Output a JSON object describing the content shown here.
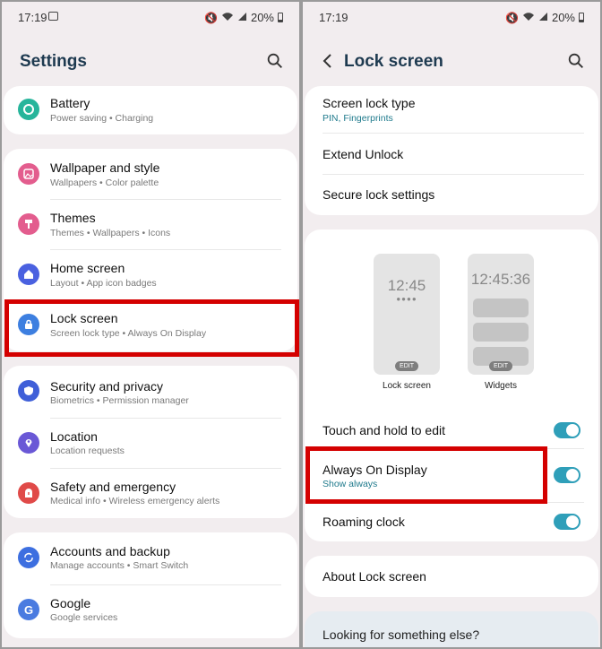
{
  "status": {
    "time": "17:19",
    "battery": "20%"
  },
  "left": {
    "title": "Settings",
    "groups": [
      {
        "items": [
          {
            "label": "Battery",
            "sub": "Power saving  •  Charging",
            "icon": "battery-icon",
            "color": "#27b59b"
          }
        ]
      },
      {
        "items": [
          {
            "label": "Wallpaper and style",
            "sub": "Wallpapers  •  Color palette",
            "icon": "wallpaper-icon",
            "color": "#e35d8e"
          },
          {
            "label": "Themes",
            "sub": "Themes  •  Wallpapers  •  Icons",
            "icon": "themes-icon",
            "color": "#e35d8e"
          },
          {
            "label": "Home screen",
            "sub": "Layout  •  App icon badges",
            "icon": "home-icon",
            "color": "#4a61e0"
          },
          {
            "label": "Lock screen",
            "sub": "Screen lock type  •  Always On Display",
            "icon": "lock-icon",
            "color": "#3d7fe0"
          }
        ]
      },
      {
        "items": [
          {
            "label": "Security and privacy",
            "sub": "Biometrics  •  Permission manager",
            "icon": "shield-icon",
            "color": "#3f5fd8"
          },
          {
            "label": "Location",
            "sub": "Location requests",
            "icon": "location-icon",
            "color": "#6a58d6"
          },
          {
            "label": "Safety and emergency",
            "sub": "Medical info  •  Wireless emergency alerts",
            "icon": "alert-icon",
            "color": "#e04a48"
          }
        ]
      },
      {
        "items": [
          {
            "label": "Accounts and backup",
            "sub": "Manage accounts  •  Smart Switch",
            "icon": "sync-icon",
            "color": "#3d6fe0"
          },
          {
            "label": "Google",
            "sub": "Google services",
            "icon": "google-icon",
            "color": "#4a7be0"
          }
        ]
      }
    ]
  },
  "right": {
    "title": "Lock screen",
    "lock_type": {
      "label": "Screen lock type",
      "sub": "PIN, Fingerprints"
    },
    "extend_unlock": "Extend Unlock",
    "secure_lock": "Secure lock settings",
    "preview_lock": {
      "clock": "12:45",
      "edit": "EDIT",
      "label": "Lock screen"
    },
    "preview_widgets": {
      "clock": "12:45:36",
      "edit": "EDIT",
      "label": "Widgets"
    },
    "touch_hold": "Touch and hold to edit",
    "aod": {
      "label": "Always On Display",
      "sub": "Show always"
    },
    "roaming_clock": "Roaming clock",
    "about": "About Lock screen",
    "looking": "Looking for something else?"
  },
  "colors": {
    "accent": "#2f9fb9",
    "highlight": "#d40000",
    "title": "#1e3a50"
  }
}
